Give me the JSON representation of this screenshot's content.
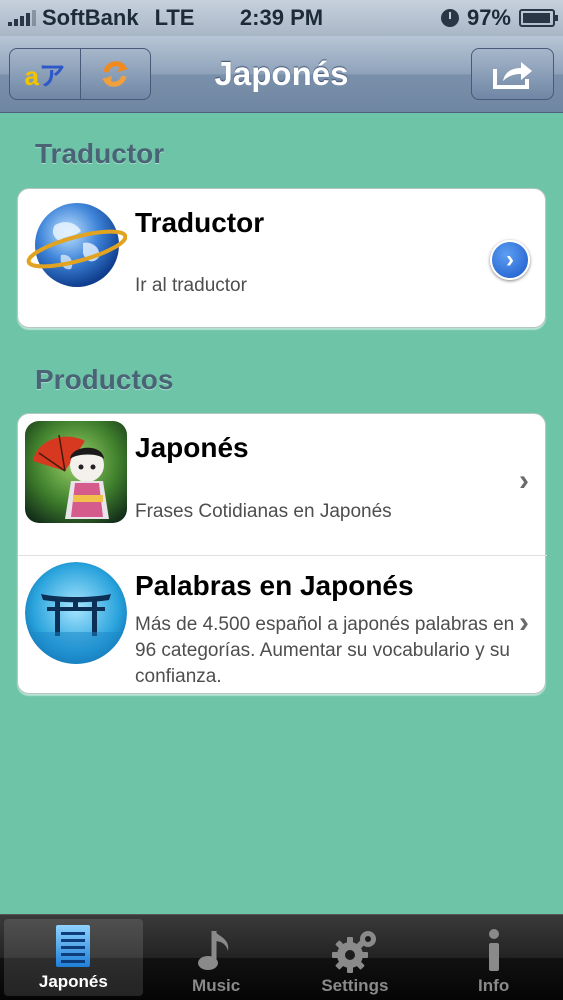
{
  "status_bar": {
    "carrier": "SoftBank",
    "network": "LTE",
    "time": "2:39 PM",
    "battery": "97%",
    "battery_level": 0.97
  },
  "nav": {
    "title": "Japonés",
    "left_buttons": [
      "translate-icon",
      "refresh-icon"
    ],
    "right_button": "share-icon"
  },
  "sections": [
    {
      "header": "Traductor",
      "items": [
        {
          "title": "Traductor",
          "subtitle": "Ir al traductor",
          "icon": "globe-icon",
          "accessory": "detail-disclosure-button"
        }
      ]
    },
    {
      "header": "Productos",
      "items": [
        {
          "title": "Japonés",
          "subtitle": "Frases Cotidianas en Japonés",
          "icon": "geisha-app-icon",
          "accessory": "chevron"
        },
        {
          "title": "Palabras en Japonés",
          "subtitle": "Más de 4.500 español a japonés palabras en 96 categorías. Aumentar su vocabulario y su confianza.",
          "icon": "torii-app-icon",
          "accessory": "chevron"
        }
      ]
    }
  ],
  "tabs": [
    {
      "label": "Japonés",
      "icon": "list-icon",
      "active": true
    },
    {
      "label": "Music",
      "icon": "music-note-icon",
      "active": false
    },
    {
      "label": "Settings",
      "icon": "gear-icon",
      "active": false
    },
    {
      "label": "Info",
      "icon": "info-icon",
      "active": false
    }
  ],
  "colors": {
    "background": "#6dc4a7",
    "section_header": "#4a6376",
    "disclosure_blue": "#1a57c9"
  }
}
